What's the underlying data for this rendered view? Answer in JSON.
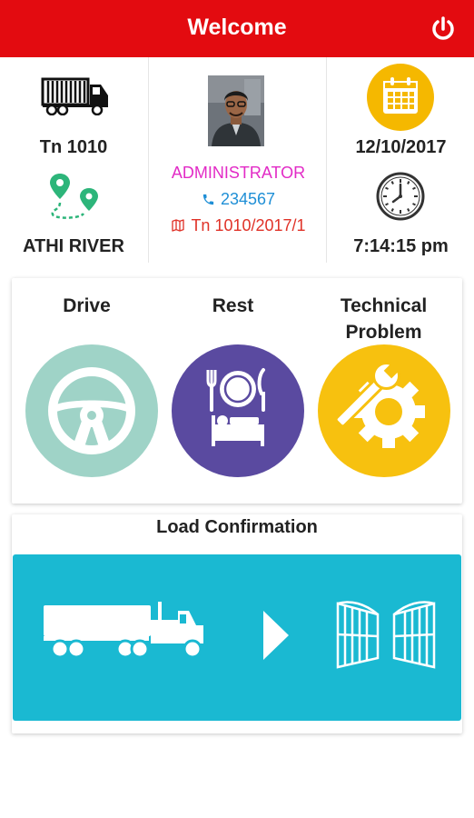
{
  "header": {
    "title": "Welcome",
    "power_icon": "power-icon"
  },
  "vehicle": {
    "id": "Tn 1010",
    "location": "ATHI RIVER"
  },
  "user": {
    "role": "ADMINISTRATOR",
    "phone": "234567",
    "trip": "Tn 1010/2017/1"
  },
  "datetime": {
    "date": "12/10/2017",
    "time": "7:14:15 pm"
  },
  "status_options": [
    {
      "label": "Drive",
      "icon": "steering-wheel-icon",
      "color": "#9fd3c7"
    },
    {
      "label": "Rest",
      "icon": "plate-bed-icon",
      "color": "#5a4aa0"
    },
    {
      "label": "Technical Problem",
      "icon": "wrench-gear-icon",
      "color": "#f7c10f"
    }
  ],
  "load_confirmation": {
    "title": "Load Confirmation",
    "color": "#1ab9d2"
  },
  "colors": {
    "appbar": "#e30b10",
    "role": "#e22bc6",
    "phone": "#1f8fd6",
    "trip": "#e03228",
    "calendar": "#f5b800"
  }
}
